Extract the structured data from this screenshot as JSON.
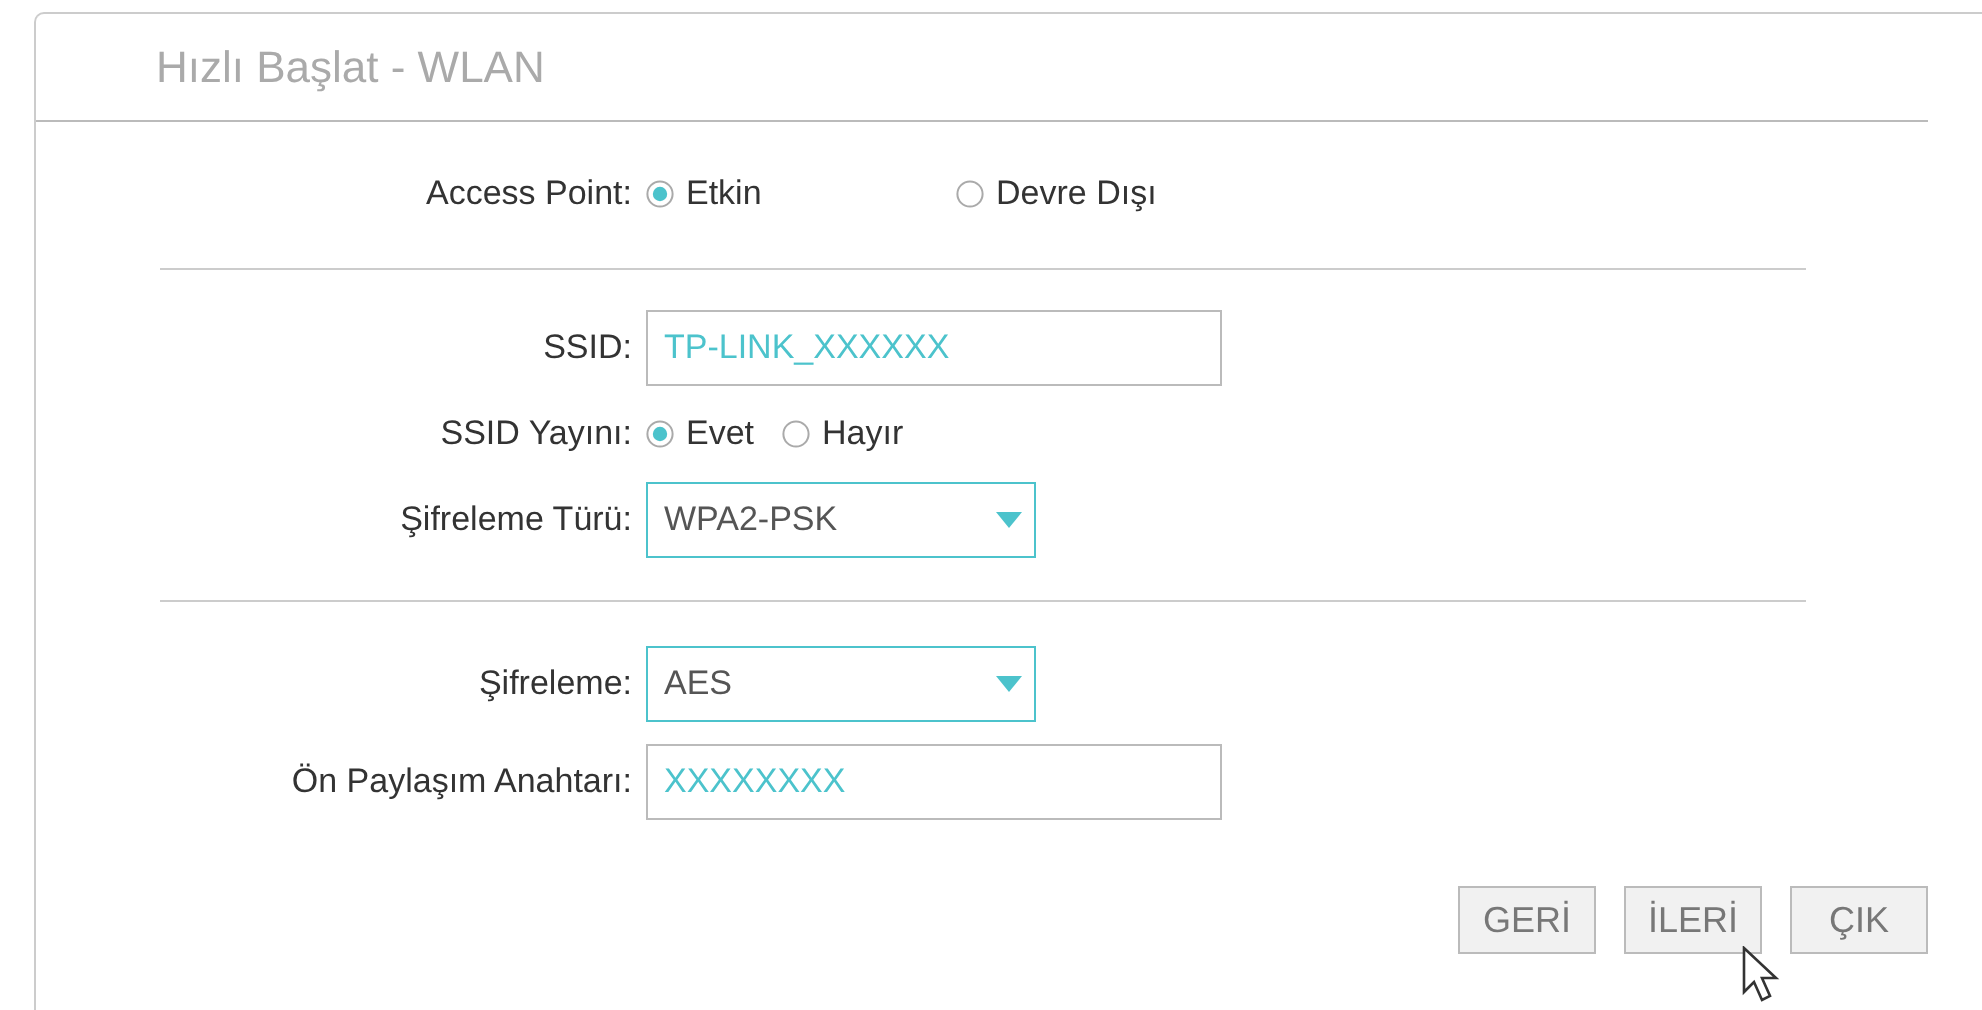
{
  "title": "Hızlı Başlat - WLAN",
  "sections": [
    [
      {
        "kind": "radio",
        "label": "Access Point:",
        "options": [
          {
            "label": "Etkin",
            "selected": true
          },
          {
            "label": "Devre Dışı",
            "selected": false
          }
        ]
      }
    ],
    [
      {
        "kind": "text",
        "label": "SSID:",
        "value": "TP-LINK_XXXXXX"
      },
      {
        "kind": "radio",
        "label": "SSID Yayını:",
        "options": [
          {
            "label": "Evet",
            "selected": true
          },
          {
            "label": "Hayır",
            "selected": false
          }
        ]
      },
      {
        "kind": "select",
        "label": "Şifreleme Türü:",
        "value": "WPA2-PSK"
      }
    ],
    [
      {
        "kind": "select",
        "label": "Şifreleme:",
        "value": "AES"
      },
      {
        "kind": "text",
        "label": "Ön Paylaşım Anahtarı:",
        "value": "XXXXXXXX"
      }
    ]
  ],
  "buttons": [
    "GERİ",
    "İLERİ",
    "ÇIK"
  ]
}
